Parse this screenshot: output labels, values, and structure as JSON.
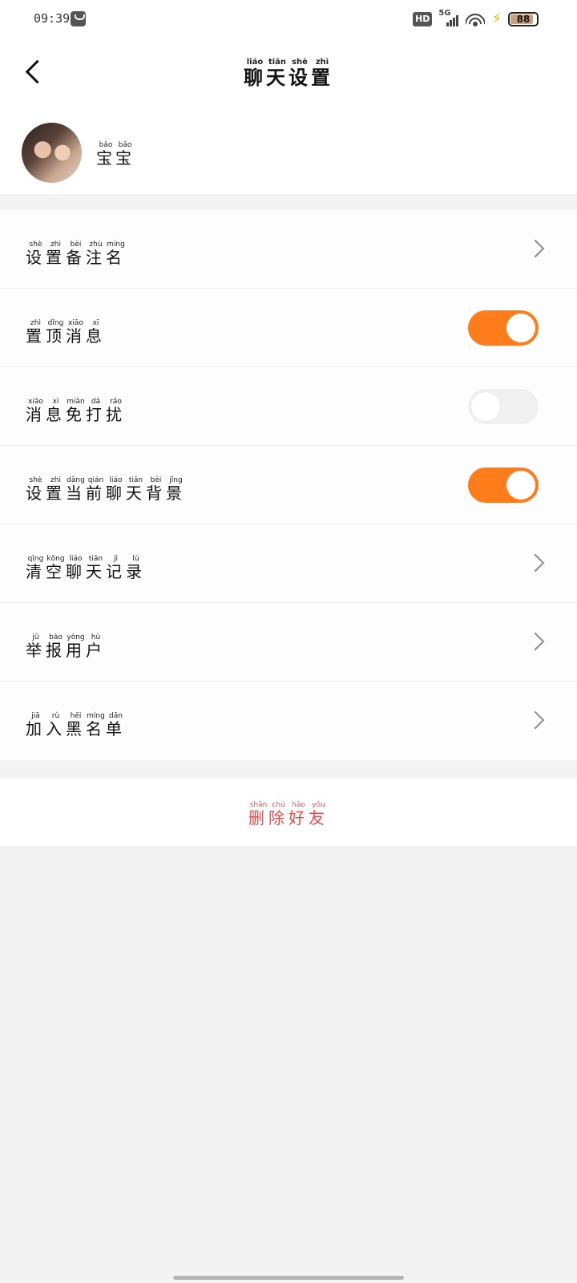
{
  "status_bar": {
    "time": "09:39",
    "hd_label": "HD",
    "network": "5G",
    "battery_percent": "88",
    "battery_level": 0.88
  },
  "header": {
    "title": [
      {
        "char": "聊",
        "pinyin": "liáo"
      },
      {
        "char": "天",
        "pinyin": "tiān"
      },
      {
        "char": "设",
        "pinyin": "shè"
      },
      {
        "char": "置",
        "pinyin": "zhì"
      }
    ],
    "back_icon": "chevron-left-icon"
  },
  "profile": {
    "name": [
      {
        "char": "宝",
        "pinyin": "bǎo"
      },
      {
        "char": "宝",
        "pinyin": "bǎo"
      }
    ]
  },
  "settings": [
    {
      "id": "set-remark",
      "control": "chevron",
      "label": [
        {
          "char": "设",
          "pinyin": "shè"
        },
        {
          "char": "置",
          "pinyin": "zhì"
        },
        {
          "char": "备",
          "pinyin": "bèi"
        },
        {
          "char": "注",
          "pinyin": "zhù"
        },
        {
          "char": "名",
          "pinyin": "míng"
        }
      ]
    },
    {
      "id": "pin-chat",
      "control": "toggle",
      "on": true,
      "label": [
        {
          "char": "置",
          "pinyin": "zhì"
        },
        {
          "char": "顶",
          "pinyin": "dǐng"
        },
        {
          "char": "消",
          "pinyin": "xiāo"
        },
        {
          "char": "息",
          "pinyin": "xī"
        }
      ]
    },
    {
      "id": "mute-notifications",
      "control": "toggle",
      "on": false,
      "label": [
        {
          "char": "消",
          "pinyin": "xiāo"
        },
        {
          "char": "息",
          "pinyin": "xī"
        },
        {
          "char": "免",
          "pinyin": "miǎn"
        },
        {
          "char": "打",
          "pinyin": "dǎ"
        },
        {
          "char": "扰",
          "pinyin": "rǎo"
        }
      ]
    },
    {
      "id": "chat-background",
      "control": "toggle",
      "on": true,
      "label": [
        {
          "char": "设",
          "pinyin": "shè"
        },
        {
          "char": "置",
          "pinyin": "zhì"
        },
        {
          "char": "当",
          "pinyin": "dāng"
        },
        {
          "char": "前",
          "pinyin": "qián"
        },
        {
          "char": "聊",
          "pinyin": "liáo"
        },
        {
          "char": "天",
          "pinyin": "tiān"
        },
        {
          "char": "背",
          "pinyin": "bèi"
        },
        {
          "char": "景",
          "pinyin": "jǐng"
        }
      ]
    },
    {
      "id": "clear-history",
      "control": "chevron",
      "label": [
        {
          "char": "清",
          "pinyin": "qīng"
        },
        {
          "char": "空",
          "pinyin": "kōng"
        },
        {
          "char": "聊",
          "pinyin": "liáo"
        },
        {
          "char": "天",
          "pinyin": "tiān"
        },
        {
          "char": "记",
          "pinyin": "jì"
        },
        {
          "char": "录",
          "pinyin": "lù"
        }
      ]
    },
    {
      "id": "report-user",
      "control": "chevron",
      "label": [
        {
          "char": "举",
          "pinyin": "jǔ"
        },
        {
          "char": "报",
          "pinyin": "bào"
        },
        {
          "char": "用",
          "pinyin": "yòng"
        },
        {
          "char": "户",
          "pinyin": "hù"
        }
      ]
    },
    {
      "id": "add-blacklist",
      "control": "chevron",
      "label": [
        {
          "char": "加",
          "pinyin": "jiā"
        },
        {
          "char": "入",
          "pinyin": "rù"
        },
        {
          "char": "黑",
          "pinyin": "hēi"
        },
        {
          "char": "名",
          "pinyin": "míng"
        },
        {
          "char": "单",
          "pinyin": "dān"
        }
      ]
    }
  ],
  "delete_friend": {
    "label": [
      {
        "char": "删",
        "pinyin": "shān"
      },
      {
        "char": "除",
        "pinyin": "chú"
      },
      {
        "char": "好",
        "pinyin": "hǎo"
      },
      {
        "char": "友",
        "pinyin": "yǒu"
      }
    ]
  },
  "colors": {
    "accent": "#ff7c1a",
    "danger": "#e84b4b",
    "background": "#f4f3f4"
  }
}
